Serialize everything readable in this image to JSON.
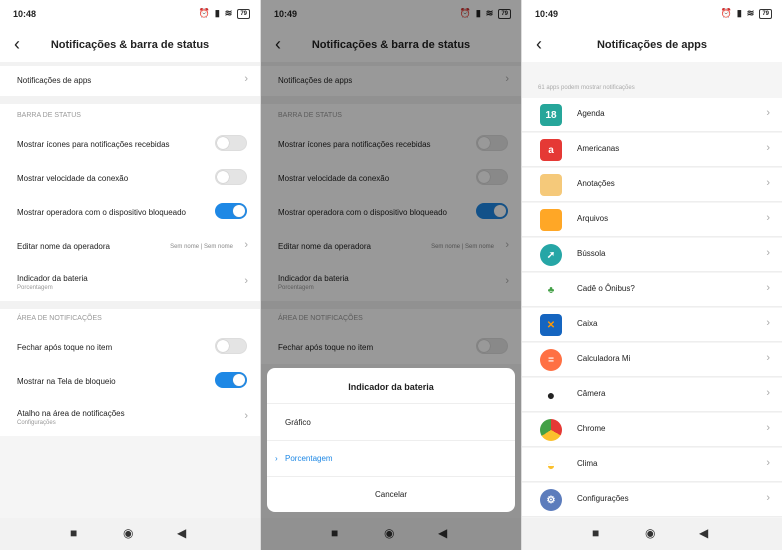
{
  "screen1": {
    "time": "10:48",
    "battery": "79",
    "title": "Notificações & barra de status",
    "app_notifications": "Notificações de apps",
    "section_status": "BARRA DE STATUS",
    "show_icons": "Mostrar ícones para notificações recebidas",
    "show_speed": "Mostrar velocidade da conexão",
    "show_carrier": "Mostrar operadora com o dispositivo bloqueado",
    "edit_carrier": "Editar nome da operadora",
    "carrier_value": "Sem nome | Sem nome",
    "battery_indicator": "Indicador da bateria",
    "battery_indicator_sub": "Porcentagem",
    "section_notif": "ÁREA DE NOTIFICAÇÕES",
    "close_after_tap": "Fechar após toque no item",
    "show_lock": "Mostrar na Tela de bloqueio",
    "shortcut": "Atalho na área de notificações",
    "shortcut_sub": "Configurações"
  },
  "screen2": {
    "time": "10:49",
    "battery": "79",
    "title": "Notificações & barra de status",
    "app_notifications": "Notificações de apps",
    "section_status": "BARRA DE STATUS",
    "show_icons": "Mostrar ícones para notificações recebidas",
    "show_speed": "Mostrar velocidade da conexão",
    "show_carrier": "Mostrar operadora com o dispositivo bloqueado",
    "edit_carrier": "Editar nome da operadora",
    "carrier_value": "Sem nome | Sem nome",
    "battery_indicator": "Indicador da bateria",
    "battery_indicator_sub": "Porcentagem",
    "section_notif": "ÁREA DE NOTIFICAÇÕES",
    "close_after_tap": "Fechar após toque no item",
    "dialog": {
      "title": "Indicador da bateria",
      "option1": "Gráfico",
      "option2": "Porcentagem",
      "cancel": "Cancelar"
    }
  },
  "screen3": {
    "time": "10:49",
    "battery": "79",
    "title": "Notificações de apps",
    "count": "61 apps podem mostrar notificações",
    "apps": [
      "Agenda",
      "Americanas",
      "Anotações",
      "Arquivos",
      "Bússola",
      "Cadê o Ônibus?",
      "Caixa",
      "Calculadora Mi",
      "Câmera",
      "Chrome",
      "Clima",
      "Configurações"
    ]
  },
  "icons": {
    "agenda": "18",
    "americanas": "a"
  },
  "colors": {
    "accent": "#1e88e5"
  }
}
